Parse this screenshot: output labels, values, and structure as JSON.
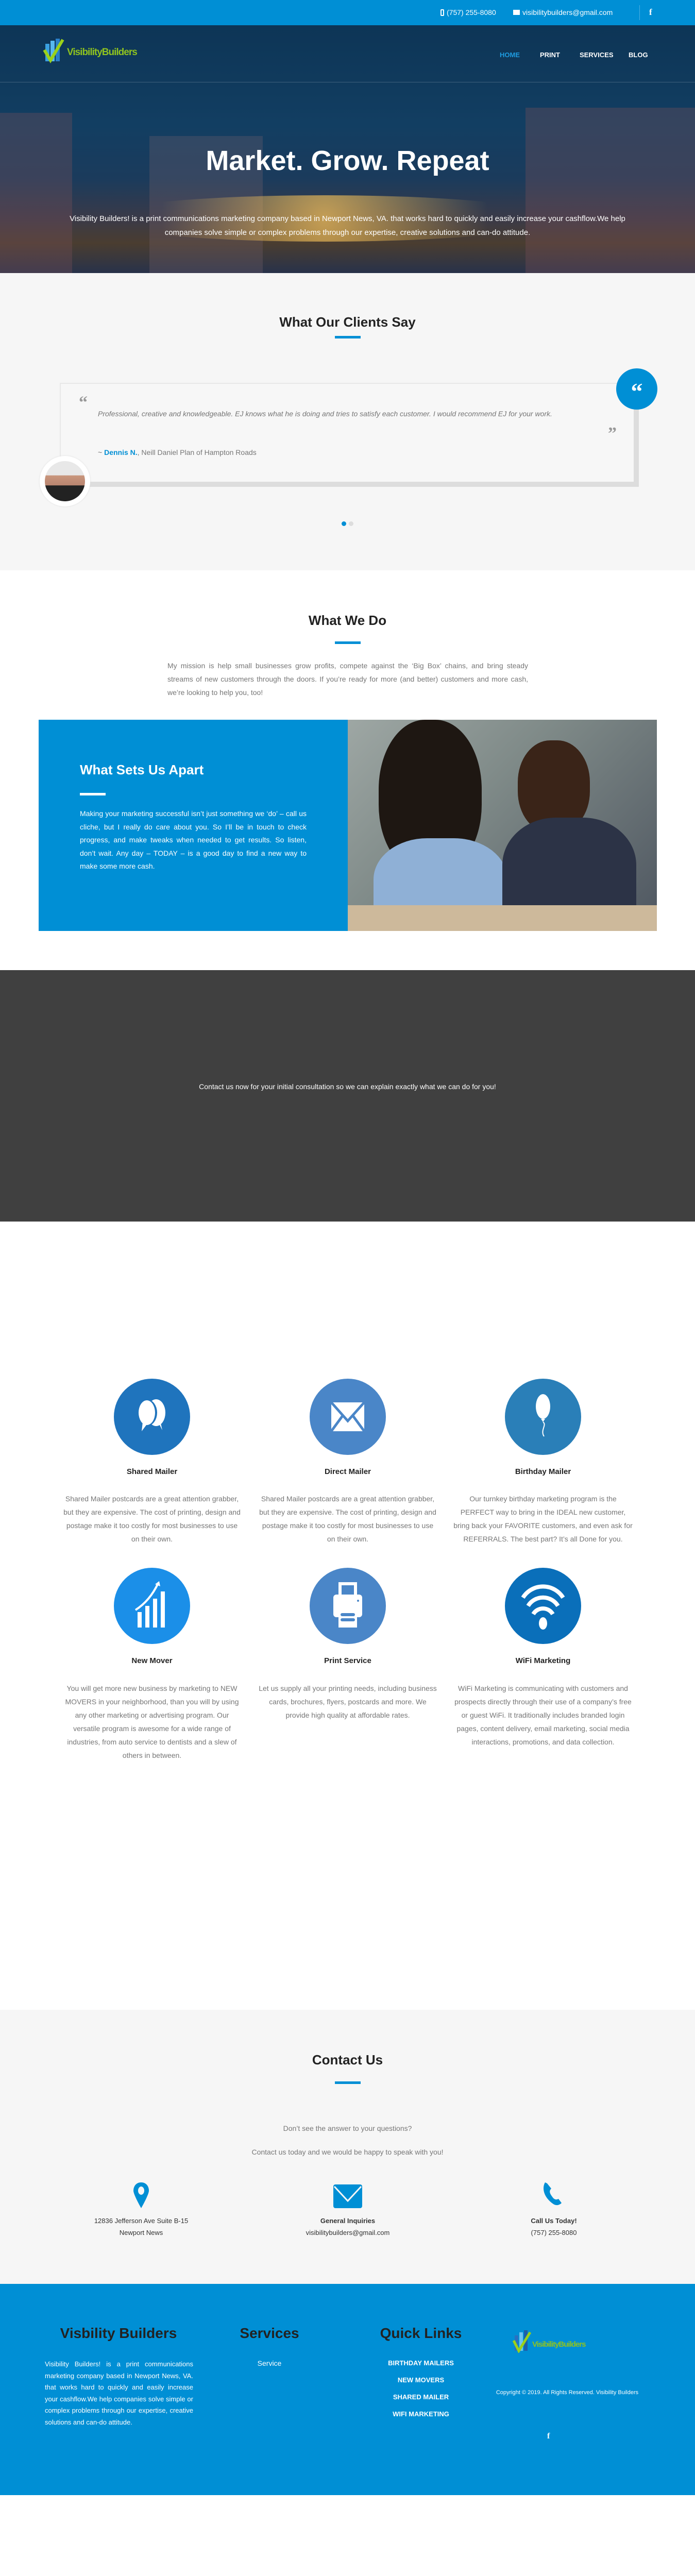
{
  "topbar": {
    "phone": "(757) 255-8080",
    "email": "visibilitybuilders@gmail.com",
    "social_icon": "facebook-icon"
  },
  "brand": {
    "logo_text": "VisibilityBuilders",
    "colors": {
      "primary": "#008fd5",
      "dark_band": "#404040",
      "light_bg": "#f6f6f6"
    }
  },
  "nav": {
    "items": [
      {
        "label": "HOME",
        "active": true
      },
      {
        "label": "PRINT"
      },
      {
        "label": "SERVICES"
      },
      {
        "label": "BLOG"
      }
    ]
  },
  "hero": {
    "title": "Market. Grow. Repeat",
    "subtitle": "Visibility Builders! is a print communications marketing company based in Newport News, VA. that works hard to quickly and easily increase your cashflow.We help companies solve simple or complex problems through our expertise, creative solutions and can-do attitude."
  },
  "testimonials": {
    "title": "What Our Clients Say",
    "quote": "Professional, creative and knowledgeable. EJ knows what he is doing and tries to satisfy each customer. I would recommend EJ for your work.",
    "author": "Dennis N.",
    "author_prefix": "~ ",
    "affiliation": ", Neill Daniel Plan of Hampton Roads",
    "slides": 2,
    "active_slide": 1
  },
  "what_we_do": {
    "title": "What We Do",
    "text": "My mission is help small businesses grow profits, compete against the ‘Big Box’ chains, and bring steady streams of new customers through the doors.  If you’re ready for more (and better) customers and more cash, we’re looking to help you, too!",
    "apart_title": "What Sets Us Apart",
    "apart_text": "Making your marketing successful isn’t just something we ‘do’ – call us cliche, but I really do care about you. So I’ll be in touch to check progress, and make tweaks when needed to get results. So listen, don’t wait. Any day – TODAY – is a good day to find a new way to make some more cash."
  },
  "cta": {
    "text": "Contact us now for your initial consultation so we can explain exactly what we can do for you!"
  },
  "services": [
    {
      "title": "Shared Mailer",
      "icon": "chat-bubbles-icon",
      "color": "#1f74bd",
      "text": "Shared Mailer postcards are a great attention grabber, but they are expensive. The cost of printing, design and postage make it too costly for most businesses to use on their own."
    },
    {
      "title": "Direct Mailer",
      "icon": "envelope-icon",
      "color": "#4a86c8",
      "text": "Shared Mailer postcards are a great attention grabber, but they are expensive. The cost of printing, design and postage make it too costly for most businesses to use on their own."
    },
    {
      "title": "Birthday Mailer",
      "icon": "balloon-icon",
      "color": "#2a7fb8",
      "text": "Our turnkey birthday marketing program is the PERFECT way to bring in the IDEAL new customer, bring back your FAVORITE customers, and even ask for REFERRALS.  The best part?  It’s all Done for you."
    },
    {
      "title": "New Mover",
      "icon": "growth-chart-icon",
      "color": "#1b8fe8",
      "text": "You will get more new business by marketing to NEW MOVERS in your neighborhood, than you will by using any other marketing or advertising program. Our versatile program is awesome for a wide range of industries, from auto service to dentists and a slew of others in between."
    },
    {
      "title": "Print Service",
      "icon": "printer-icon",
      "color": "#4a86c8",
      "text": "Let us supply all your printing needs, including business cards, brochures, flyers, postcards and more. We provide high quality at affordable rates."
    },
    {
      "title": "WiFi Marketing",
      "icon": "wifi-icon",
      "color": "#0a6fba",
      "text": "WiFi Marketing is communicating with customers and prospects directly through their use of a company’s free or guest WiFi. It traditionally includes branded login pages, content delivery, email marketing, social media interactions, promotions, and data collection."
    }
  ],
  "contact": {
    "title": "Contact Us",
    "line1": "Don’t see the answer to your questions?",
    "line2": "Contact us today and we would be happy to speak with you!",
    "columns": [
      {
        "icon": "map-pin-icon",
        "heading": "",
        "lines": [
          "12836 Jefferson Ave Suite B-15",
          "Newport News"
        ]
      },
      {
        "icon": "envelope-icon",
        "heading": "General Inquiries",
        "lines": [
          "visibilitybuilders@gmail.com"
        ]
      },
      {
        "icon": "phone-icon",
        "heading": "Call Us Today!",
        "lines": [
          "(757) 255-8080"
        ]
      }
    ]
  },
  "footer": {
    "about_title": "Visbility Builders",
    "about_text": "Visibility Builders! is a print communications marketing company based in Newport News, VA. that works hard to quickly and easily increase your cashflow.We help companies solve simple or complex problems through our expertise, creative solutions and can-do attitude.",
    "services_title": "Services",
    "services_links": [
      "Service"
    ],
    "quick_title": "Quick Links",
    "quick_links": [
      "BIRTHDAY MAILERS",
      "NEW MOVERS",
      "SHARED MAILER",
      "WIFI MARKETING"
    ],
    "copyright": "Copyright © 2019. All Rights Reserved. Visibility Builders",
    "social_icon": "facebook-icon"
  }
}
